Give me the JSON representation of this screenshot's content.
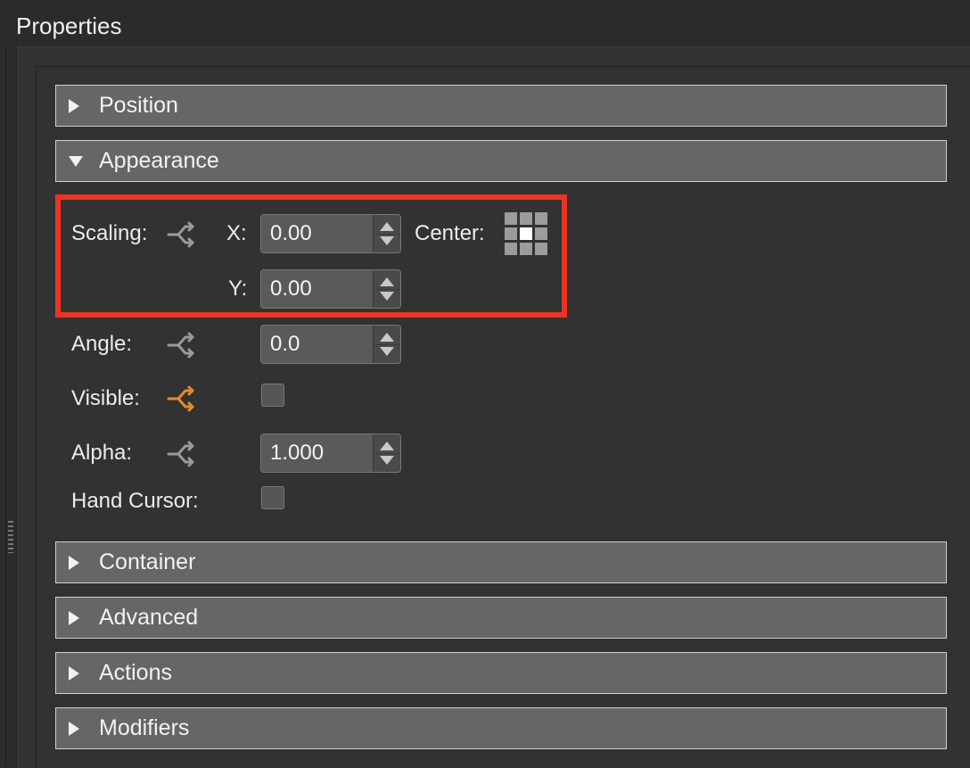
{
  "panel": {
    "title": "Properties"
  },
  "sections": {
    "position": "Position",
    "appearance": "Appearance",
    "container": "Container",
    "advanced": "Advanced",
    "actions": "Actions",
    "modifiers": "Modifiers"
  },
  "appearance": {
    "scaling": {
      "label": "Scaling:",
      "x_label": "X:",
      "x_value": "0.00",
      "y_label": "Y:",
      "y_value": "0.00",
      "center_label": "Center:"
    },
    "angle": {
      "label": "Angle:",
      "value": "0.0"
    },
    "visible": {
      "label": "Visible:"
    },
    "alpha": {
      "label": "Alpha:",
      "value": "1.000"
    },
    "hand_cursor": {
      "label": "Hand Cursor:"
    }
  },
  "colors": {
    "link_inactive": "#9a9a9a",
    "link_active": "#e8892c",
    "highlight": "#ee3322"
  },
  "icons": {
    "link": "link-icon",
    "expand": "triangle-right-icon",
    "collapse": "triangle-down-icon"
  }
}
